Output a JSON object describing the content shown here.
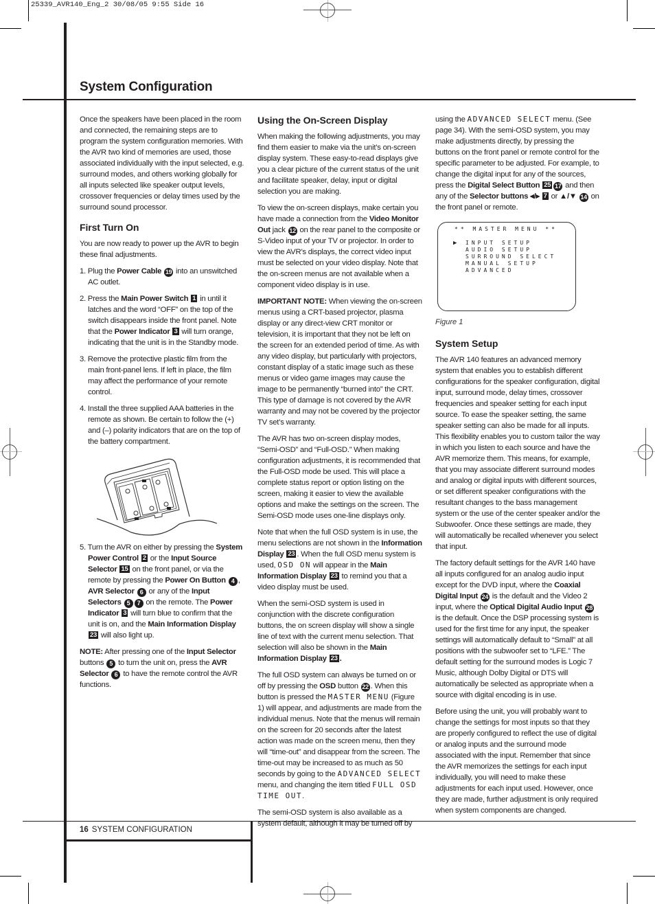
{
  "slug": "25339_AVR140_Eng_2  30/08/05  9:55  Side 16",
  "title": "System Configuration",
  "col1": {
    "intro": "Once the speakers have been placed in the room and connected, the remaining steps are to program the system configuration memories. With the AVR two kind of memories are used, those associated individually with the input selected, e.g. surround modes, and others working globally for all inputs selected like speaker output levels, crossover frequencies or delay times used by the surround sound processor.",
    "h_first": "First Turn On",
    "first_intro": "You are now ready to power up the AVR to begin these final adjustments.",
    "s1_a": "1. Plug the ",
    "s1_b": "Power Cable",
    "s1_n": "19",
    "s1_c": " into an unswitched AC outlet.",
    "s2_a": "2. Press the ",
    "s2_b": "Main Power Switch",
    "s2_n": "1",
    "s2_c": " in until it latches and the word “OFF” on the top of the switch disappears inside the front panel. Note that the ",
    "s2_d": "Power Indicator",
    "s2_n2": "3",
    "s2_e": " will turn orange, indicating that the unit is in the Standby mode.",
    "s3": "3. Remove the protective plastic film from the main front-panel lens. If left in place, the film may affect the performance of your remote control.",
    "s4": "4. Install the three supplied AAA batteries in the remote as shown. Be certain to follow the (+) and (–) polarity indicators that are on the top of the battery compartment.",
    "s5_a": "5. Turn the AVR on either by pressing the ",
    "s5_b": "System Power Control",
    "s5_n1": "2",
    "s5_c": " or the ",
    "s5_d": "Input Source Selector",
    "s5_n2": "15",
    "s5_e": " on the front panel, or via the remote by pressing the ",
    "s5_f": "Power On Button",
    "s5_n3": "4",
    "s5_g": ", ",
    "s5_h": "AVR Selector",
    "s5_n4": "6",
    "s5_i": " or any of the ",
    "s5_j": "Input Selectors",
    "s5_n5": "5",
    "s5_n6": "7",
    "s5_k": " on the remote. The ",
    "s5_l": "Power Indicator",
    "s5_n7": "3",
    "s5_m": " will turn blue to confirm that the unit is on, and the ",
    "s5_o": "Main Information Display",
    "s5_n8": "23",
    "s5_p": " will also light up.",
    "note_a": "NOTE:",
    "note_b": " After pressing one of the ",
    "note_c": "Input Selector",
    "note_d": " buttons ",
    "note_n1": "5",
    "note_e": " to turn the unit on, press the ",
    "note_f": "AVR Selector",
    "note_n2": "6",
    "note_g": " to have the remote control the AVR functions."
  },
  "col2": {
    "h_osd": "Using the On-Screen Display",
    "p1": "When making the following adjustments, you may find them easier to make via the unit’s on-screen display system. These easy-to-read displays give you a clear picture of the current status of the unit and facilitate speaker, delay, input or digital selection you are making.",
    "p2_a": "To view the on-screen displays, make certain you have made a connection from the ",
    "p2_b": "Video Monitor Out",
    "p2_c": " jack ",
    "p2_n": "12",
    "p2_d": " on the rear panel to the composite or S-Video input of your TV or projector. In order to view the AVR’s displays, the correct video input must be selected on your video display. Note that the on-screen menus are not available when a component video display is in use.",
    "p3_a": "IMPORTANT NOTE:",
    "p3_b": " When viewing the on-screen menus using a CRT-based projector, plasma display or any direct-view CRT monitor or television, it is important that they not be left on the screen for an extended period of time. As with any video display, but particularly with projectors, constant display of a static image such as these menus or video game images may cause the image to be permanently “burned into” the CRT. This type of damage is not covered by the AVR warranty and may not be covered by the projector TV set’s warranty.",
    "p4": "The AVR has two on-screen display modes, “Semi-OSD” and “Full-OSD.” When making configuration adjustments, it is recommended that the Full-OSD mode be used. This will place a complete status report or option listing on the screen, making it easier to view the available options and make the settings on the screen. The Semi-OSD mode uses one-line displays only.",
    "p5_a": "Note that when the full OSD system is in use, the menu selections are not shown in the ",
    "p5_b": "Information Display",
    "p5_n": "23",
    "p5_c": ". When the full OSD menu system is used, ",
    "p5_lcd": "OSD ON",
    "p5_d": " will appear in the ",
    "p5_e": "Main Information Display",
    "p5_n2": "23",
    "p5_f": " to remind you that a video display must be used.",
    "p6_a": "When the semi-OSD system is used in conjunction with the discrete configuration buttons, the on screen display will show a single line of text with the current menu selection. That selection will also be shown in the ",
    "p6_b": "Main Information Display",
    "p6_n": "23",
    "p6_c": ".",
    "p7_a": "The full OSD system can always be turned on or off by pressing the ",
    "p7_b": "OSD",
    "p7_c": " button ",
    "p7_n": "22",
    "p7_d": ". When this button is pressed the ",
    "p7_lcd1": "MASTER MENU",
    "p7_e": " (Figure 1) will appear, and adjustments are made from the individual menus. Note that the menus will remain on the screen for 20 seconds after the latest action was made on the screen menu, then they will “time-out” and disappear from the screen. The time-out may be increased to as much as 50 seconds by going to the ",
    "p7_lcd2": "ADVANCED SELECT",
    "p7_f": " menu, and changing the item titled ",
    "p7_lcd3": "FULL OSD TIME OUT",
    "p7_g": ".",
    "p8": "The semi-OSD system is also available as a system default, although it may be turned off by"
  },
  "col3": {
    "p1_a": "using the ",
    "p1_lcd": "ADVANCED SELECT",
    "p1_b": " menu. (See page 34). With the semi-OSD system, you may make adjustments directly, by pressing the buttons on the front panel or remote control for the specific parameter to be adjusted. For example, to change the digital input for any of the sources, press the ",
    "p1_c": "Digital Select Button",
    "p1_n1": "25",
    "p1_n2": "17",
    "p1_d": " and then any of the ",
    "p1_e": "Selector buttons ◂/▸",
    "p1_n3": "7",
    "p1_f": " or ",
    "p1_g": "▲/▼",
    "p1_n4": "14",
    "p1_h": " on the front panel or remote.",
    "figure": {
      "header": "** MASTER MENU **",
      "cursor": "▶",
      "items": [
        "INPUT SETUP",
        "AUDIO SETUP",
        "SURROUND SELECT",
        "MANUAL SETUP",
        "ADVANCED"
      ],
      "caption": "Figure 1"
    },
    "h_setup": "System Setup",
    "p2": "The AVR 140 features an advanced memory system that enables you to establish different configurations for the speaker configuration, digital input, surround mode, delay times, crossover frequencies and speaker setting for each input source. To ease the speaker setting, the same speaker setting can also be made for all inputs. This flexibility enables you to custom tailor the way in which you listen to each source and have the AVR memorize them. This means, for example, that you may associate different surround modes and analog or digital inputs with different sources, or set different speaker configurations with the resultant changes to the bass management system or the use of the center speaker and/or the Subwoofer. Once these settings are made, they will automatically be recalled whenever you select that input.",
    "p3_a": "The factory default settings for the AVR 140 have all inputs configured for an analog audio input except for the DVD input, where the ",
    "p3_b": "Coaxial Digital Input",
    "p3_n1": "24",
    "p3_c": " is the default and the Video 2 input, where the ",
    "p3_d": "Optical Digital Audio Input",
    "p3_n2": "28",
    "p3_e": " is the default. Once the DSP processing system is used for the first time for any input, the speaker settings will automatically default to “Small” at all positions with the subwoofer set to “LFE.” The default setting for the surround modes is Logic 7 Music, although Dolby Digital or DTS will automatically be selected as appropriate when a source with digital encoding is in use.",
    "p4": "Before using the unit, you will probably want to change the settings for most inputs so that they are properly configured to reflect the use of digital or analog inputs and the surround mode associated with the input. Remember that since the AVR memorizes the settings for each input individually, you will need to make these adjustments for each input used. However, once they are made, further adjustment is only required when system components are changed."
  },
  "footer": {
    "page_number": "16",
    "section": "SYSTEM CONFIGURATION"
  }
}
